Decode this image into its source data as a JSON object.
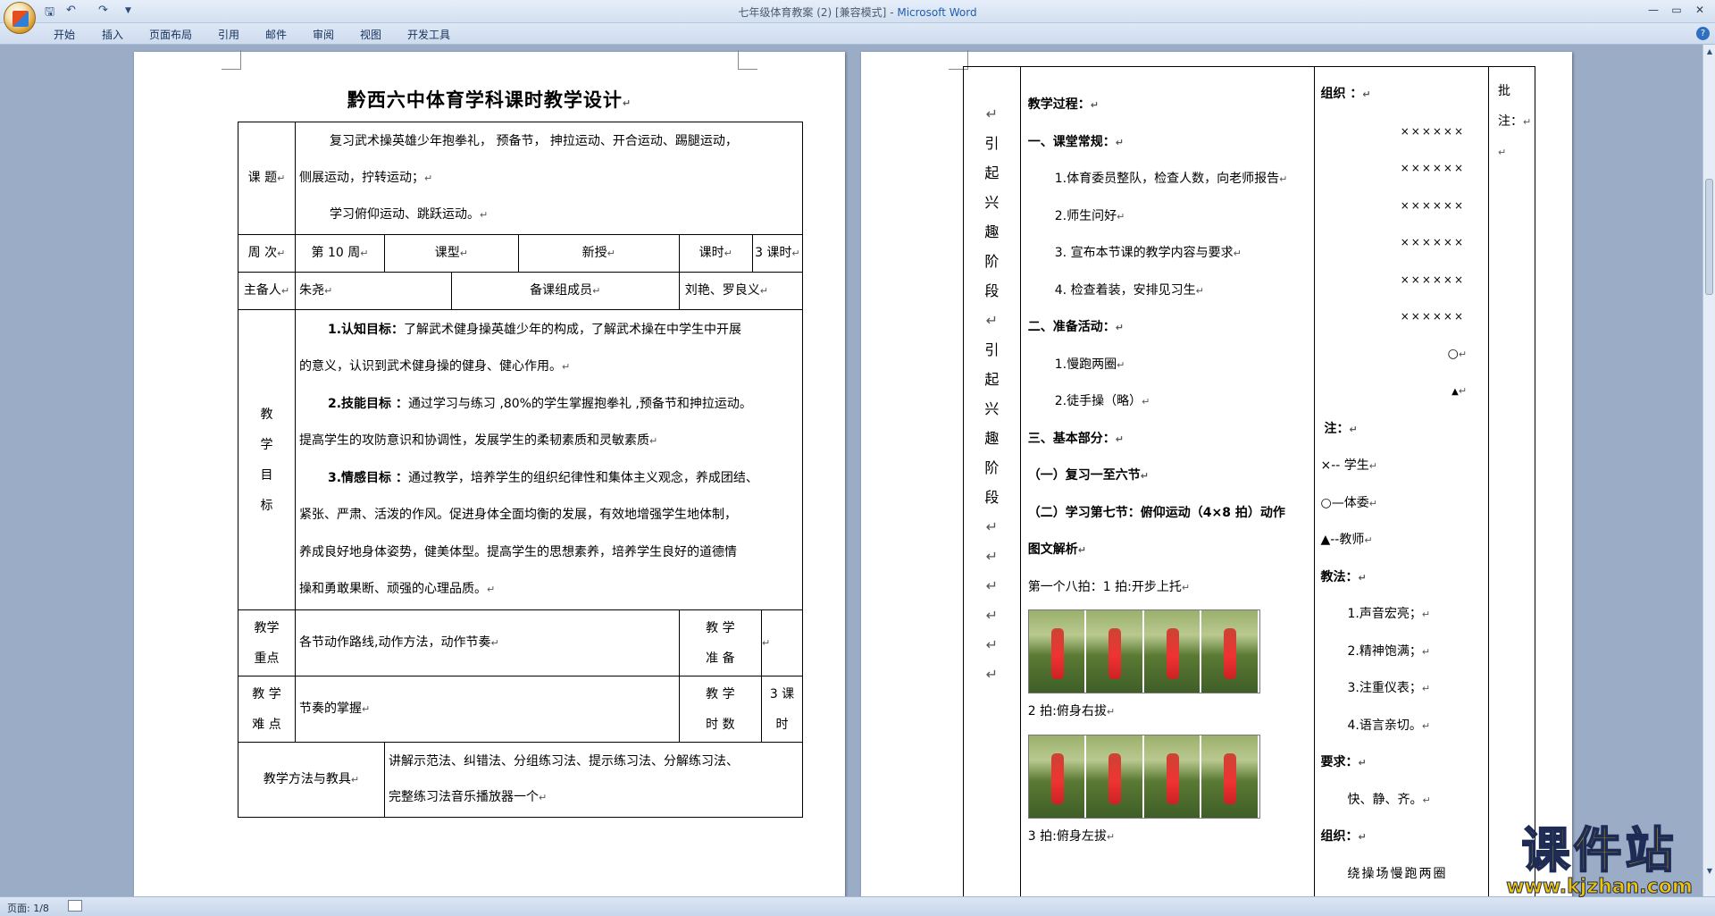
{
  "window": {
    "title": "七年级体育教案 (2) [兼容模式]",
    "app_name": "Microsoft Word",
    "title_sep": " - "
  },
  "menu": [
    "开始",
    "插入",
    "页面布局",
    "引用",
    "邮件",
    "审阅",
    "视图",
    "开发工具"
  ],
  "status": {
    "page": "页面: 1/8"
  },
  "watermark": {
    "big": "课件站",
    "small": "www.kjzhan.com"
  },
  "page1": {
    "title": "黔西六中体育学科课时教学设计",
    "topic_label": "课 题",
    "topic_lines": [
      "复习武术操英雄少年抱拳礼， 预备节， 抻拉运动、开合运动、踢腿运动，",
      "侧展运动，拧转运动；",
      "学习俯仰运动、跳跃运动。"
    ],
    "week_label": "周 次",
    "week": "第 10 周",
    "type_label": "课型",
    "type": "新授",
    "hours_label": "课时",
    "hours": "3 课时",
    "lead_label": "主备人",
    "lead": "朱尧",
    "group_label": "备课组成员",
    "group": "刘艳、罗良义",
    "goals_label": [
      "教",
      "学",
      "目",
      "标"
    ],
    "goals": [
      {
        "h": "1.认知目标：",
        "t": "了解武术健身操英雄少年的构成，了解武术操在中学生中开展",
        "t2": "的意义，认识到武术健身操的健身、健心作用。"
      },
      {
        "h": "2.技能目标 ：",
        "t": "通过学习与练习 ,80%的学生掌握抱拳礼 ,预备节和抻拉运动。",
        "t2": "提高学生的攻防意识和协调性，发展学生的柔韧素质和灵敏素质"
      },
      {
        "h": "3.情感目标 ：",
        "t": "通过教学，培养学生的组织纪律性和集体主义观念，养成团结、",
        "t2": "紧张、严肃、活泼的作风。促进身体全面均衡的发展，有效地增强学生地体制，",
        "t3": "养成良好地身体姿势，健美体型。提高学生的思想素养，培养学生良好的道德情",
        "t4": "操和勇敢果断、顽强的心理品质。"
      }
    ],
    "key_label1": "教学",
    "key_label2": "重点",
    "key": "各节动作路线,动作方法，动作节奏",
    "prep_label1": "教 学",
    "prep_label2": "准 备",
    "diff_label1": "教 学",
    "diff_label2": "难 点",
    "diff": "节奏的掌握",
    "time_label1": "教 学",
    "time_label2": "时 数",
    "time1": "3 课",
    "time2": "时",
    "method_label": "教学方法与教具",
    "method_lines": [
      "讲解示范法、纠错法、分组练习法、提示练习法、分解练习法、",
      "完整练习法音乐播放器一个"
    ]
  },
  "page2": {
    "stage_chars": [
      "引",
      "起",
      "兴",
      "趣",
      "阶",
      "段"
    ],
    "process": {
      "title": "教学过程：",
      "s1": "一、课堂常规：",
      "s1_items": [
        "1.体育委员整队，检查人数，向老师报告",
        "2.师生问好",
        "3. 宣布本节课的教学内容与要求",
        "4. 检查着装，安排见习生"
      ],
      "s2": "二、准备活动：",
      "s2_items": [
        "1.慢跑两圈",
        "2.徒手操（略）"
      ],
      "s3": "三、基本部分：",
      "s3_a": "（一）复习一至六节",
      "s3_b": "（二）学习第七节：俯仰运动（4×8 拍）动作",
      "s3_c": "图文解析",
      "beat1": "第一个八拍：1 拍:开步上托",
      "beat2": "2 拍:俯身右拔",
      "beat3": "3 拍:俯身左拔"
    },
    "org": {
      "title": "组织 ：",
      "rows": [
        "××××××",
        "××××××",
        "××××××",
        "××××××",
        "××××××",
        "××××××"
      ],
      "circle": "○",
      "triangle": "▲",
      "note_title": "注：",
      "legend": [
        "×-- 学生",
        "○—体委",
        "▲--教师"
      ],
      "method_title": "教法：",
      "methods": [
        "1.声音宏亮；",
        "2.精神饱满；",
        "3.注重仪表；",
        "4.语言亲切。"
      ],
      "req_title": "要求：",
      "req": "快、静、齐。",
      "org2_title": "组织：",
      "org2": "绕操场慢跑两圈"
    },
    "notes": {
      "label1": "批",
      "label2": "注："
    }
  }
}
